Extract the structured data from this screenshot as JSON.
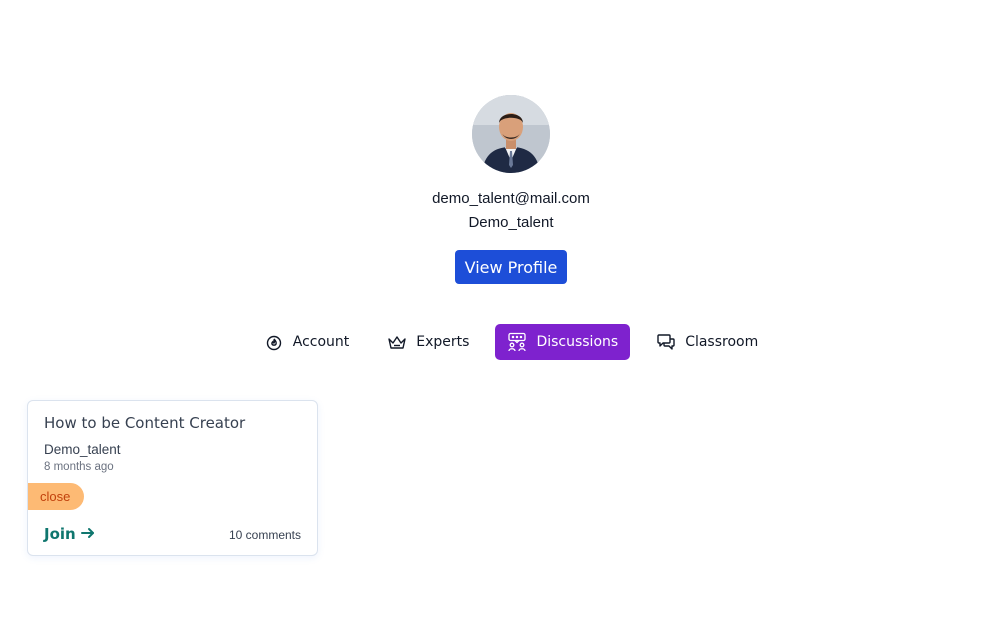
{
  "profile": {
    "email": "demo_talent@mail.com",
    "username": "Demo_talent",
    "view_profile_label": "View Profile"
  },
  "tabs": [
    {
      "label": "Account",
      "icon": "badge-flame-icon",
      "active": false
    },
    {
      "label": "Experts",
      "icon": "crown-icon",
      "active": false
    },
    {
      "label": "Discussions",
      "icon": "discussion-icon",
      "active": true
    },
    {
      "label": "Classroom",
      "icon": "chat-bubbles-icon",
      "active": false
    }
  ],
  "discussions": [
    {
      "title": "How to be Content Creator",
      "author": "Demo_talent",
      "time": "8 months ago",
      "status": "close",
      "join_label": "Join",
      "comments": "10 comments"
    }
  ],
  "colors": {
    "primary_button": "#1d4ed8",
    "active_tab": "#7e22ce",
    "badge_bg": "#fdba74",
    "badge_text": "#c2410c",
    "join_text": "#0f766e"
  }
}
